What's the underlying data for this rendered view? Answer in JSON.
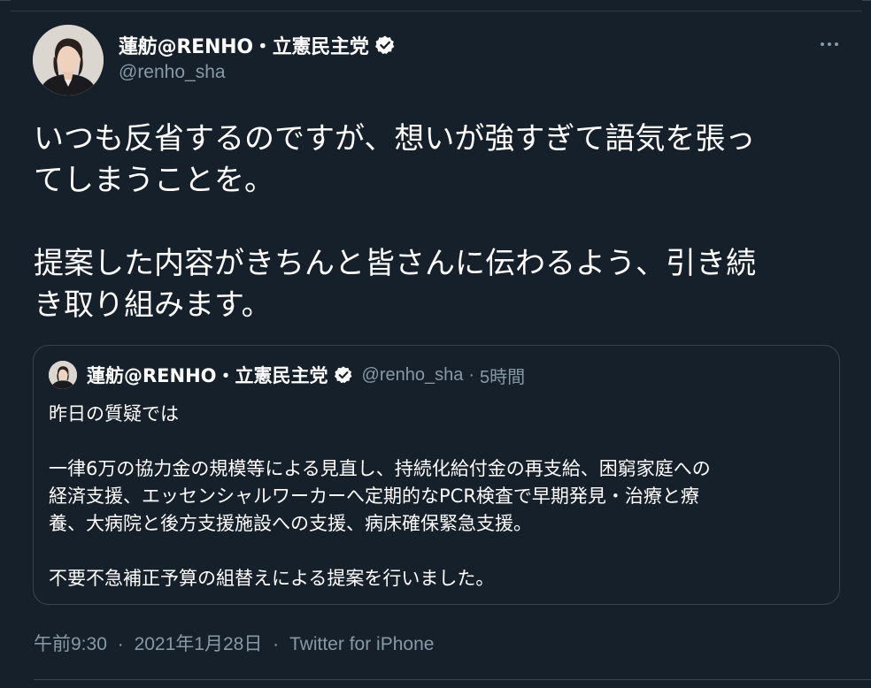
{
  "tweet": {
    "display_name": "蓮舫@RENHO・立憲民主党",
    "handle": "@renho_sha",
    "text_lines": [
      "いつも反省するのですが、想いが強すぎて語気を張っ",
      "てしまうことを。",
      "提案した内容がきちんと皆さんに伝わるよう、引き続",
      "き取り組みます。"
    ],
    "time": "午前9:30",
    "date": "2021年1月28日",
    "source": "Twitter for iPhone",
    "separator": "·"
  },
  "quote": {
    "display_name": "蓮舫@RENHO・立憲民主党",
    "handle": "@renho_sha",
    "time_ago": "5時間",
    "separator": "·",
    "lines": [
      "昨日の質疑では",
      "一律6万の協力金の規模等による見直し、持続化給付金の再支給、困窮家庭への",
      "経済支援、エッセンシャルワーカーへ定期的なPCR検査で早期発見・治療と療",
      "養、大病院と後方支援施設への支援、病床確保緊急支援。",
      "不要不急補正予算の組替えによる提案を行いました。"
    ]
  },
  "icons": {
    "verified": "verified-badge-icon",
    "more": "more-options-icon"
  },
  "colors": {
    "background": "#15202b",
    "text": "#ffffff",
    "muted": "#8899a6",
    "border": "#38444d"
  }
}
